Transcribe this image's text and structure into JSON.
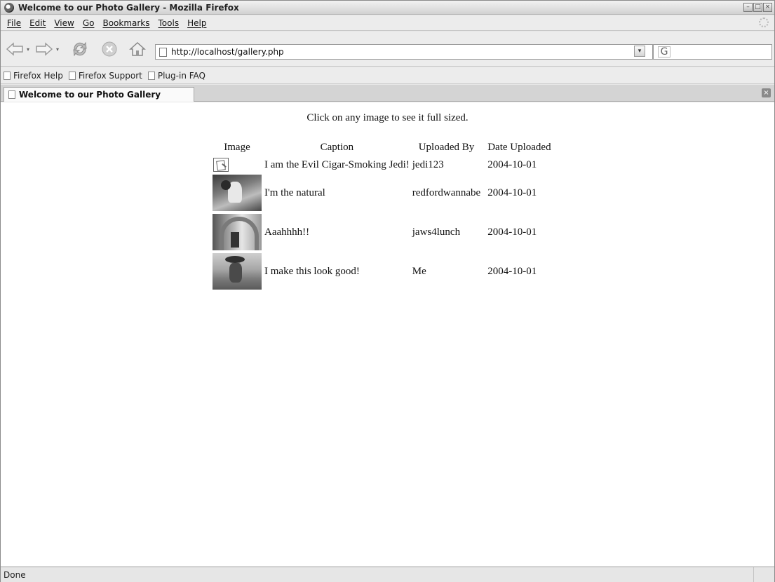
{
  "window": {
    "title": "Welcome to our Photo Gallery - Mozilla Firefox"
  },
  "menubar": {
    "items": [
      "File",
      "Edit",
      "View",
      "Go",
      "Bookmarks",
      "Tools",
      "Help"
    ]
  },
  "navbar": {
    "url": "http://localhost/gallery.php",
    "search_engine_icon": "google-icon"
  },
  "bookmarks": {
    "items": [
      "Firefox Help",
      "Firefox Support",
      "Plug-in FAQ"
    ]
  },
  "tabs": [
    {
      "label": "Welcome to our Photo Gallery"
    }
  ],
  "page": {
    "intro": "Click on any image to see it full sized.",
    "table": {
      "headers": [
        "Image",
        "Caption",
        "Uploaded By",
        "Date Uploaded"
      ],
      "rows": [
        {
          "image": "broken-image-icon",
          "caption": "I am the Evil Cigar-Smoking Jedi!",
          "uploaded_by": "jedi123",
          "date": "2004-10-01"
        },
        {
          "image": "photo-thumbnail",
          "caption": "I'm the natural",
          "uploaded_by": "redfordwannabe",
          "date": "2004-10-01"
        },
        {
          "image": "photo-thumbnail",
          "caption": "Aaahhhh!!",
          "uploaded_by": "jaws4lunch",
          "date": "2004-10-01"
        },
        {
          "image": "photo-thumbnail",
          "caption": "I make this look good!",
          "uploaded_by": "Me",
          "date": "2004-10-01"
        }
      ]
    }
  },
  "status": {
    "text": "Done"
  }
}
